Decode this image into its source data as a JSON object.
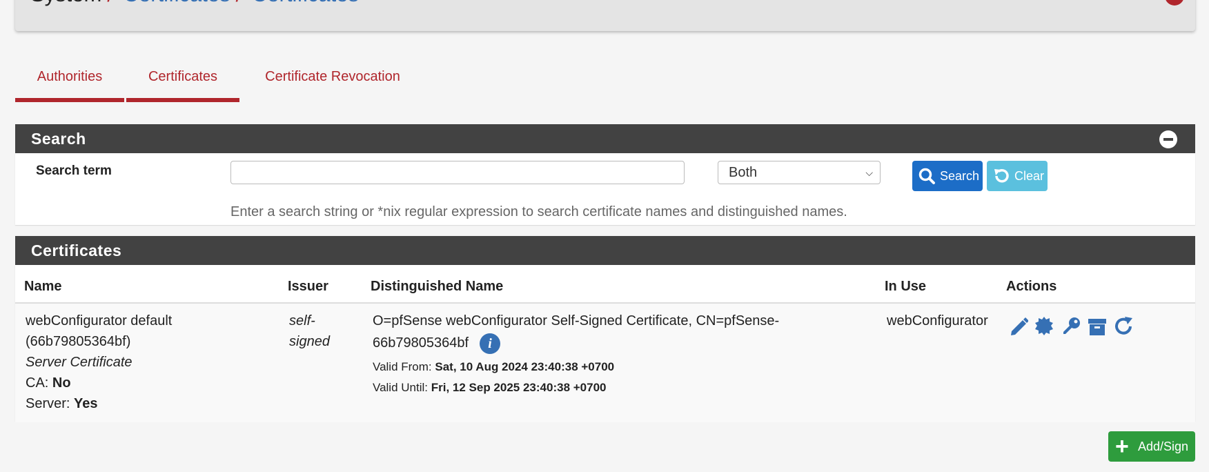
{
  "breadcrumb": {
    "root": "System",
    "sep": "/",
    "link1": "Certificates",
    "link2": "Certificates",
    "help_glyph": "?"
  },
  "tabs": [
    {
      "label": "Authorities",
      "active": true
    },
    {
      "label": "Certificates",
      "active": true
    },
    {
      "label": "Certificate Revocation",
      "active": false
    }
  ],
  "search_panel": {
    "title": "Search",
    "label": "Search term",
    "input_value": "",
    "select_value": "Both",
    "search_button": "Search",
    "clear_button": "Clear",
    "help": "Enter a search string or *nix regular expression to search certificate names and distinguished names."
  },
  "certs_panel": {
    "title": "Certificates",
    "columns": [
      "Name",
      "Issuer",
      "Distinguished Name",
      "In Use",
      "Actions"
    ],
    "rows": [
      {
        "name_line1": "webConfigurator default",
        "name_line2": "(66b79805364bf)",
        "name_type": "Server Certificate",
        "ca_label": "CA:",
        "ca_value": "No",
        "server_label": "Server:",
        "server_value": "Yes",
        "issuer_line1": "self-",
        "issuer_line2": "signed",
        "dn_line1": "O=pfSense webConfigurator Self-Signed Certificate, CN=pfSense-",
        "dn_line2": "66b79805364bf",
        "info_glyph": "i",
        "valid_from_label": "Valid From:",
        "valid_from": "Sat, 10 Aug 2024 23:40:38 +0700",
        "valid_until_label": "Valid Until:",
        "valid_until": "Fri, 12 Sep 2025 23:40:38 +0700",
        "in_use": "webConfigurator",
        "actions": [
          "pencil-icon",
          "certificate-icon",
          "key-icon",
          "archive-icon",
          "refresh-icon"
        ]
      }
    ]
  },
  "add_button": {
    "plus": "+",
    "label": "Add/Sign"
  },
  "colors": {
    "accent": "#b0262c",
    "link": "#3670b4",
    "primary": "#1c6dc7",
    "info": "#5bc0de",
    "success": "#2e9c3d",
    "panel_heading": "#424242"
  }
}
